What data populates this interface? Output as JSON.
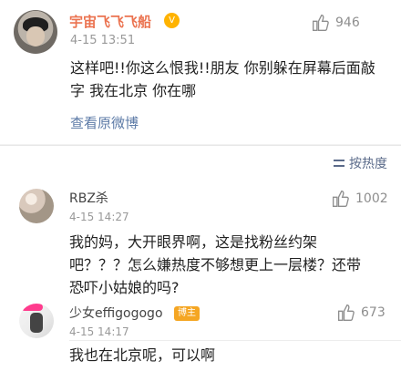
{
  "main_post": {
    "username": "宇宙飞飞飞船",
    "vip_badge": "V",
    "timestamp": "4-15 13:51",
    "likes": "946",
    "text": "这样吧!!你这么恨我!!朋友 你别躲在屏幕后面敲字 我在北京 你在哪",
    "view_original": "查看原微博"
  },
  "sort": {
    "label": "按热度"
  },
  "comments": [
    {
      "username": "RBZ杀",
      "timestamp": "4-15 14:27",
      "likes": "1002",
      "text": "我的妈，大开眼界啊，这是找粉丝约架吧？？？怎么嫌热度不够想更上一层楼？还带恐吓小姑娘的吗?"
    },
    {
      "username": "少女effigogogo",
      "badge": "博主",
      "timestamp": "4-15 14:17",
      "likes": "673",
      "text": "我也在北京呢，可以啊"
    }
  ],
  "colors": {
    "accent": "#eb7350",
    "link": "#5d7ba7",
    "badge_vip": "#ffb300",
    "badge_creator": "#f5a623"
  },
  "icons": {
    "like": "thumbs-up-icon",
    "sort": "sort-lines-icon",
    "vip": "vip-badge-icon",
    "creator": "creator-badge-icon"
  }
}
